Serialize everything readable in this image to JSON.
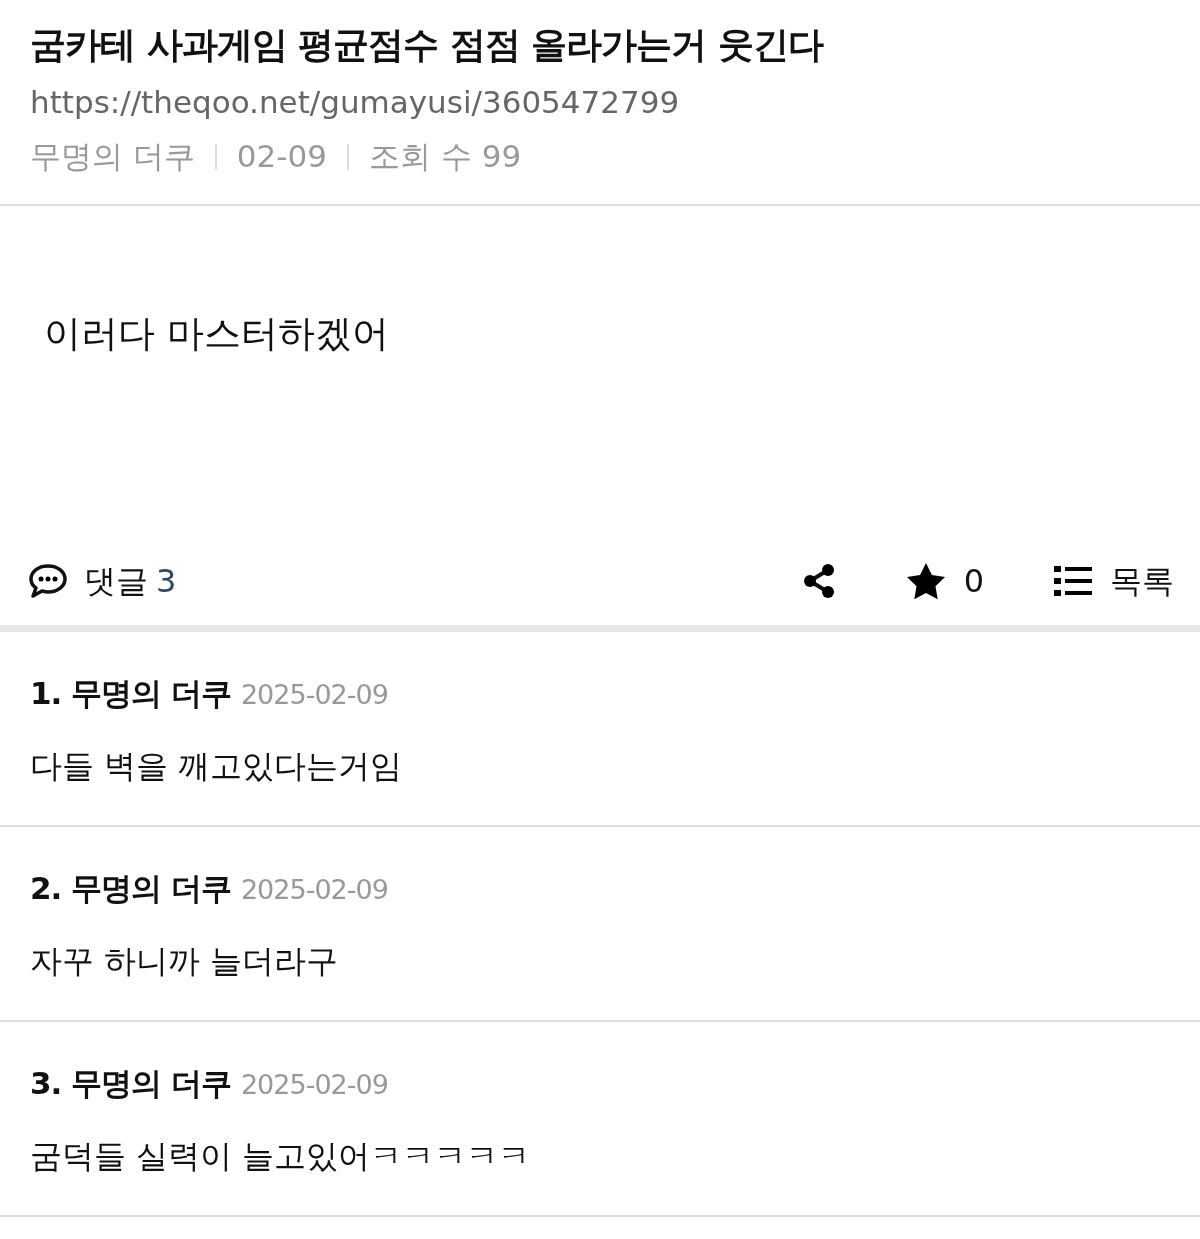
{
  "post": {
    "title": "굼카테 사과게임 평균점수 점점 올라가는거 웃긴다",
    "url": "https://theqoo.net/gumayusi/3605472799",
    "author": "무명의 더쿠",
    "date": "02-09",
    "views": "조회 수 99",
    "body": "이러다 마스터하겠어"
  },
  "actions": {
    "comment_label": "댓글",
    "comment_count": "3",
    "star_count": "0",
    "list_label": "목록"
  },
  "comments": [
    {
      "number": "1.",
      "author": "무명의 더쿠",
      "date": "2025-02-09",
      "text": "다들 벽을 깨고있다는거임"
    },
    {
      "number": "2.",
      "author": "무명의 더쿠",
      "date": "2025-02-09",
      "text": "자꾸 하니까 늘더라구"
    },
    {
      "number": "3.",
      "author": "무명의 더쿠",
      "date": "2025-02-09",
      "text": "굼덕들 실력이 늘고있어ㅋㅋㅋㅋㅋ"
    }
  ]
}
